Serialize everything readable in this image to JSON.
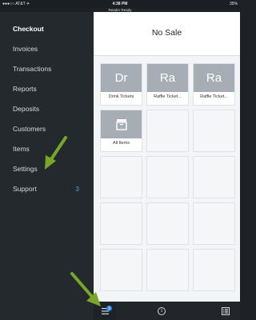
{
  "status_bar": {
    "carrier": "●●●○○ AT&T ✈",
    "time": "4:38 PM",
    "reader": "Reader Ready",
    "battery": "35%"
  },
  "sidebar": {
    "items": [
      {
        "label": "Checkout",
        "active": true
      },
      {
        "label": "Invoices"
      },
      {
        "label": "Transactions"
      },
      {
        "label": "Reports"
      },
      {
        "label": "Deposits"
      },
      {
        "label": "Customers"
      },
      {
        "label": "Items"
      },
      {
        "label": "Settings"
      },
      {
        "label": "Support",
        "badge": "3"
      }
    ]
  },
  "main": {
    "title": "No Sale",
    "tiles": [
      {
        "abbr": "Dr",
        "label": "Drink Tickets"
      },
      {
        "abbr": "Ra",
        "label": "Raffle Ticket..."
      },
      {
        "abbr": "Ra",
        "label": "Raffle Ticket..."
      },
      {
        "icon": "box-icon",
        "label": "All Items"
      }
    ]
  },
  "bottom_bar": {
    "menu_badge": "3",
    "center_count": "1",
    "right_icon": "list-icon",
    "left_icon": "menu-icon"
  },
  "colors": {
    "sidebar_bg": "#24292e",
    "main_bg": "#f3f4f5",
    "tile_gray": "#a6adb4",
    "accent_blue": "#2f86e5",
    "arrow_green": "#77a82a"
  }
}
